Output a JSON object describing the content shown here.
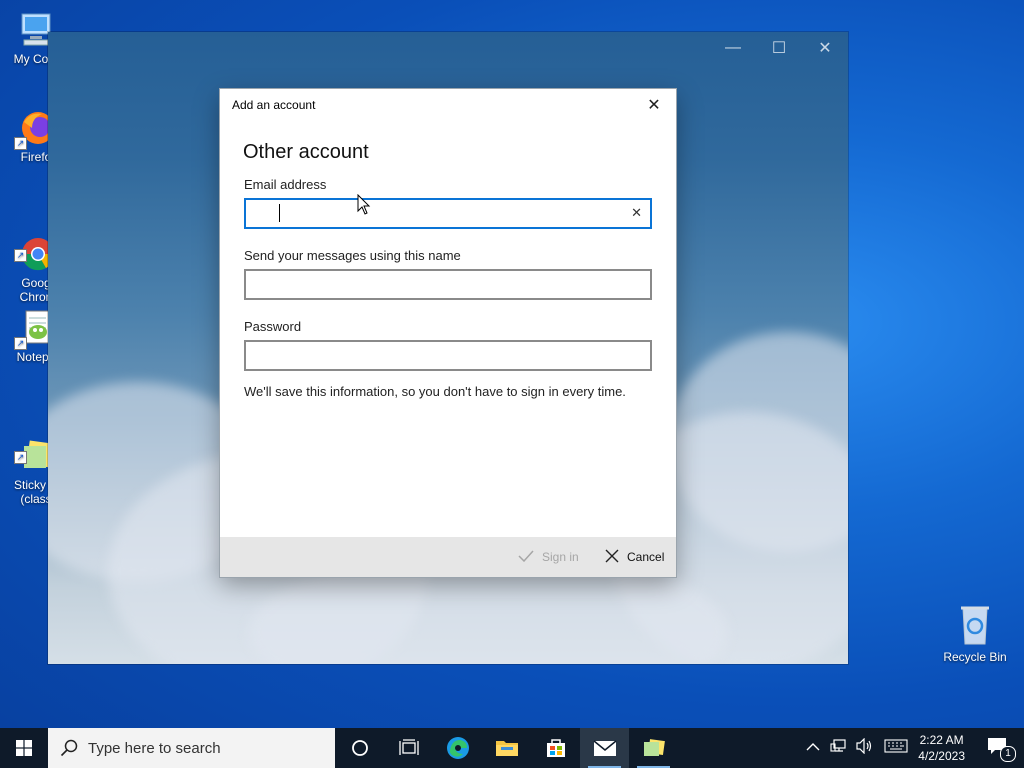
{
  "desktop": {
    "icons": [
      {
        "label": "My Com"
      },
      {
        "label": "Firefo"
      },
      {
        "label": "Goog\nChron"
      },
      {
        "label": "Notepa"
      },
      {
        "label": "Sticky N\n(class"
      }
    ],
    "recycle_bin": {
      "label": "Recycle Bin"
    }
  },
  "dialog": {
    "title": "Add an account",
    "heading": "Other account",
    "email": {
      "label": "Email address",
      "value": "",
      "placeholder": ""
    },
    "name": {
      "label": "Send your messages using this name",
      "value": ""
    },
    "password": {
      "label": "Password",
      "value": ""
    },
    "info": "We'll save this information, so you don't have to sign in every time.",
    "signin_label": "Sign in",
    "cancel_label": "Cancel"
  },
  "taskbar": {
    "search_placeholder": "Type here to search",
    "time": "2:22 AM",
    "date": "4/2/2023",
    "notification_count": "1"
  },
  "colors": {
    "accent": "#0a74d6",
    "taskbar": "#0e1a29",
    "footer": "#e6e6e6"
  }
}
